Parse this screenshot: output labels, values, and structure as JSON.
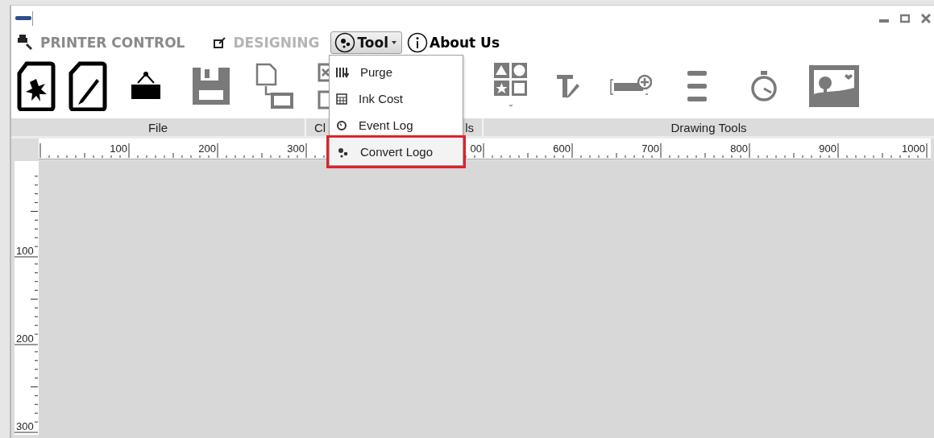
{
  "menu_bar": {
    "tabs": [
      {
        "label": "PRINTER CONTROL",
        "selected": false,
        "kind": "printer"
      },
      {
        "label": "DESIGNING",
        "selected": true,
        "kind": "design"
      }
    ],
    "tool_button": {
      "label": "Tool",
      "expanded": true
    },
    "about_link": {
      "label": "About Us"
    }
  },
  "ribbon_groups": [
    {
      "label": "File"
    },
    {
      "label": "Cl"
    },
    {
      "label": "ls"
    },
    {
      "label": "Drawing Tools"
    }
  ],
  "tool_menu": {
    "items": [
      {
        "label": "Purge",
        "kind": "purge",
        "selected": false
      },
      {
        "label": "Ink Cost",
        "kind": "ink",
        "selected": false
      },
      {
        "label": "Event Log",
        "kind": "log",
        "selected": false
      },
      {
        "label": "Convert Logo",
        "kind": "convert",
        "selected": true
      }
    ]
  },
  "ruler": {
    "horizontal": [
      "100",
      "200",
      "300",
      "00",
      "600",
      "700",
      "800",
      "900",
      "1000"
    ],
    "vertical": [
      "100",
      "200",
      "300"
    ]
  }
}
